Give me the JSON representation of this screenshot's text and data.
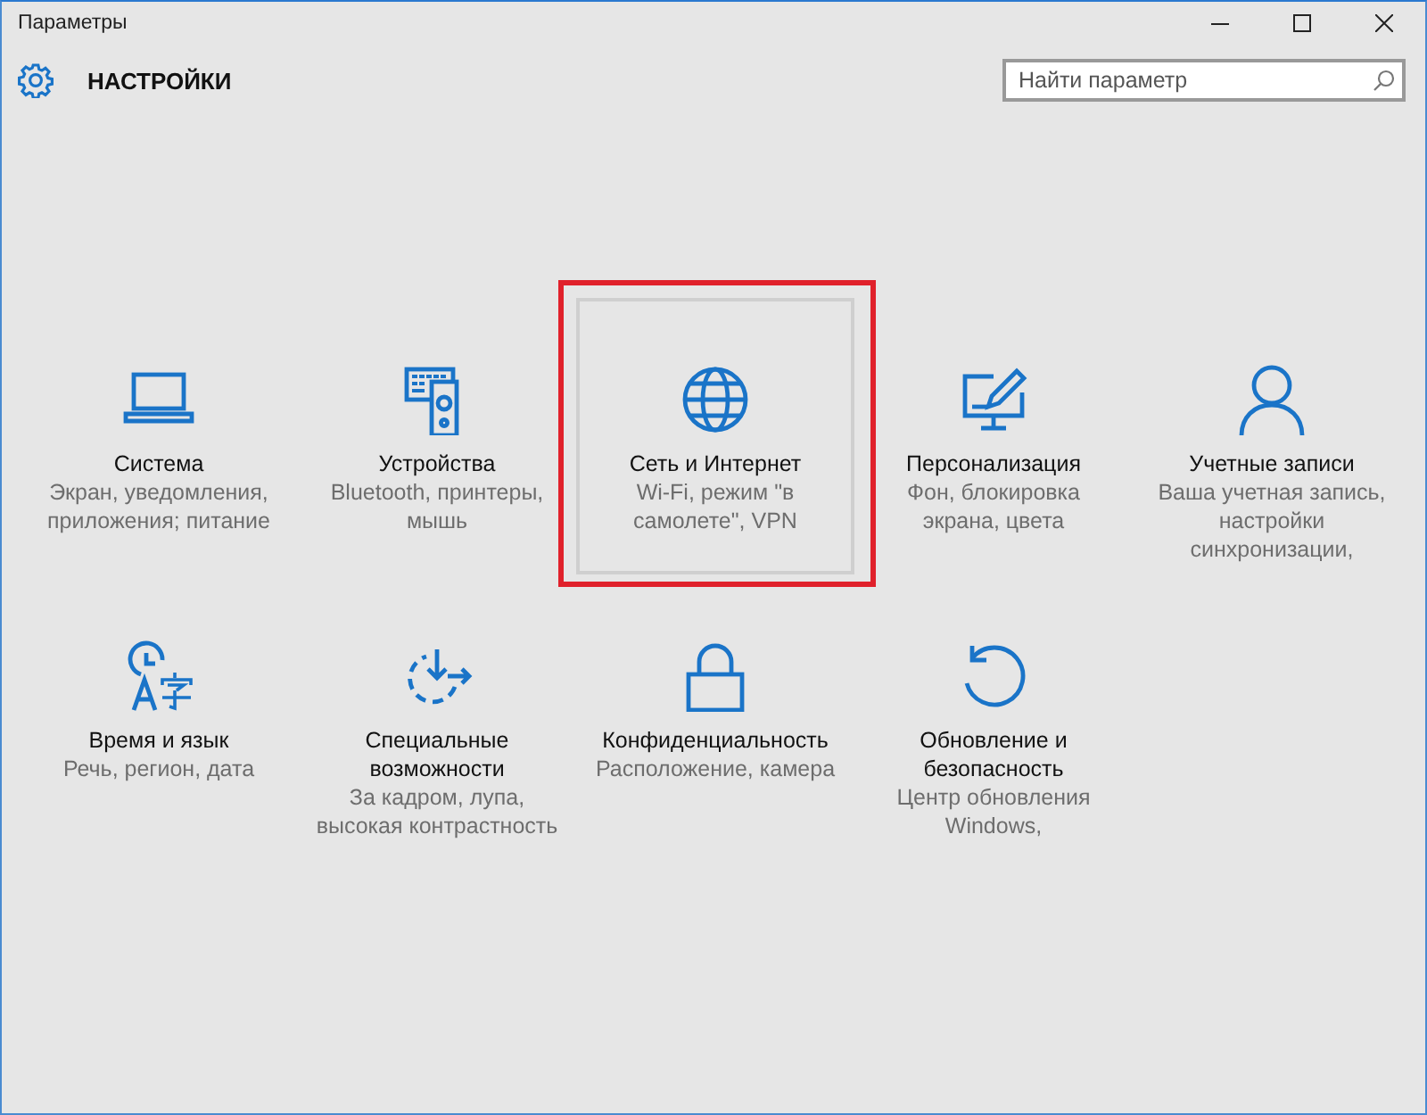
{
  "window": {
    "title": "Параметры"
  },
  "header": {
    "title": "НАСТРОЙКИ"
  },
  "search": {
    "placeholder": "Найти параметр"
  },
  "tiles": [
    {
      "kind": "laptop",
      "title": "Система",
      "description": "Экран, уведомления, приложения; питание",
      "highlighted": false
    },
    {
      "kind": "devices",
      "title": "Устройства",
      "description": "Bluetooth, принтеры, мышь",
      "highlighted": false
    },
    {
      "kind": "globe",
      "title": "Сеть и Интернет",
      "description": "Wi-Fi, режим \"в самолете\", VPN",
      "highlighted": true
    },
    {
      "kind": "brush",
      "title": "Персонализация",
      "description": "Фон, блокировка экрана, цвета",
      "highlighted": false
    },
    {
      "kind": "person",
      "title": "Учетные записи",
      "description": "Ваша учетная запись, настройки синхронизации,",
      "highlighted": false
    },
    {
      "kind": "language",
      "title": "Время и язык",
      "description": "Речь, регион, дата",
      "highlighted": false
    },
    {
      "kind": "access",
      "title": "Специальные возможности",
      "description": "За кадром, лупа, высокая контрастность",
      "highlighted": false
    },
    {
      "kind": "lock",
      "title": "Конфиденциальность",
      "description": "Расположение, камера",
      "highlighted": false
    },
    {
      "kind": "update",
      "title": "Обновление и безопасность",
      "description": "Центр обновления Windows,",
      "highlighted": false
    }
  ]
}
